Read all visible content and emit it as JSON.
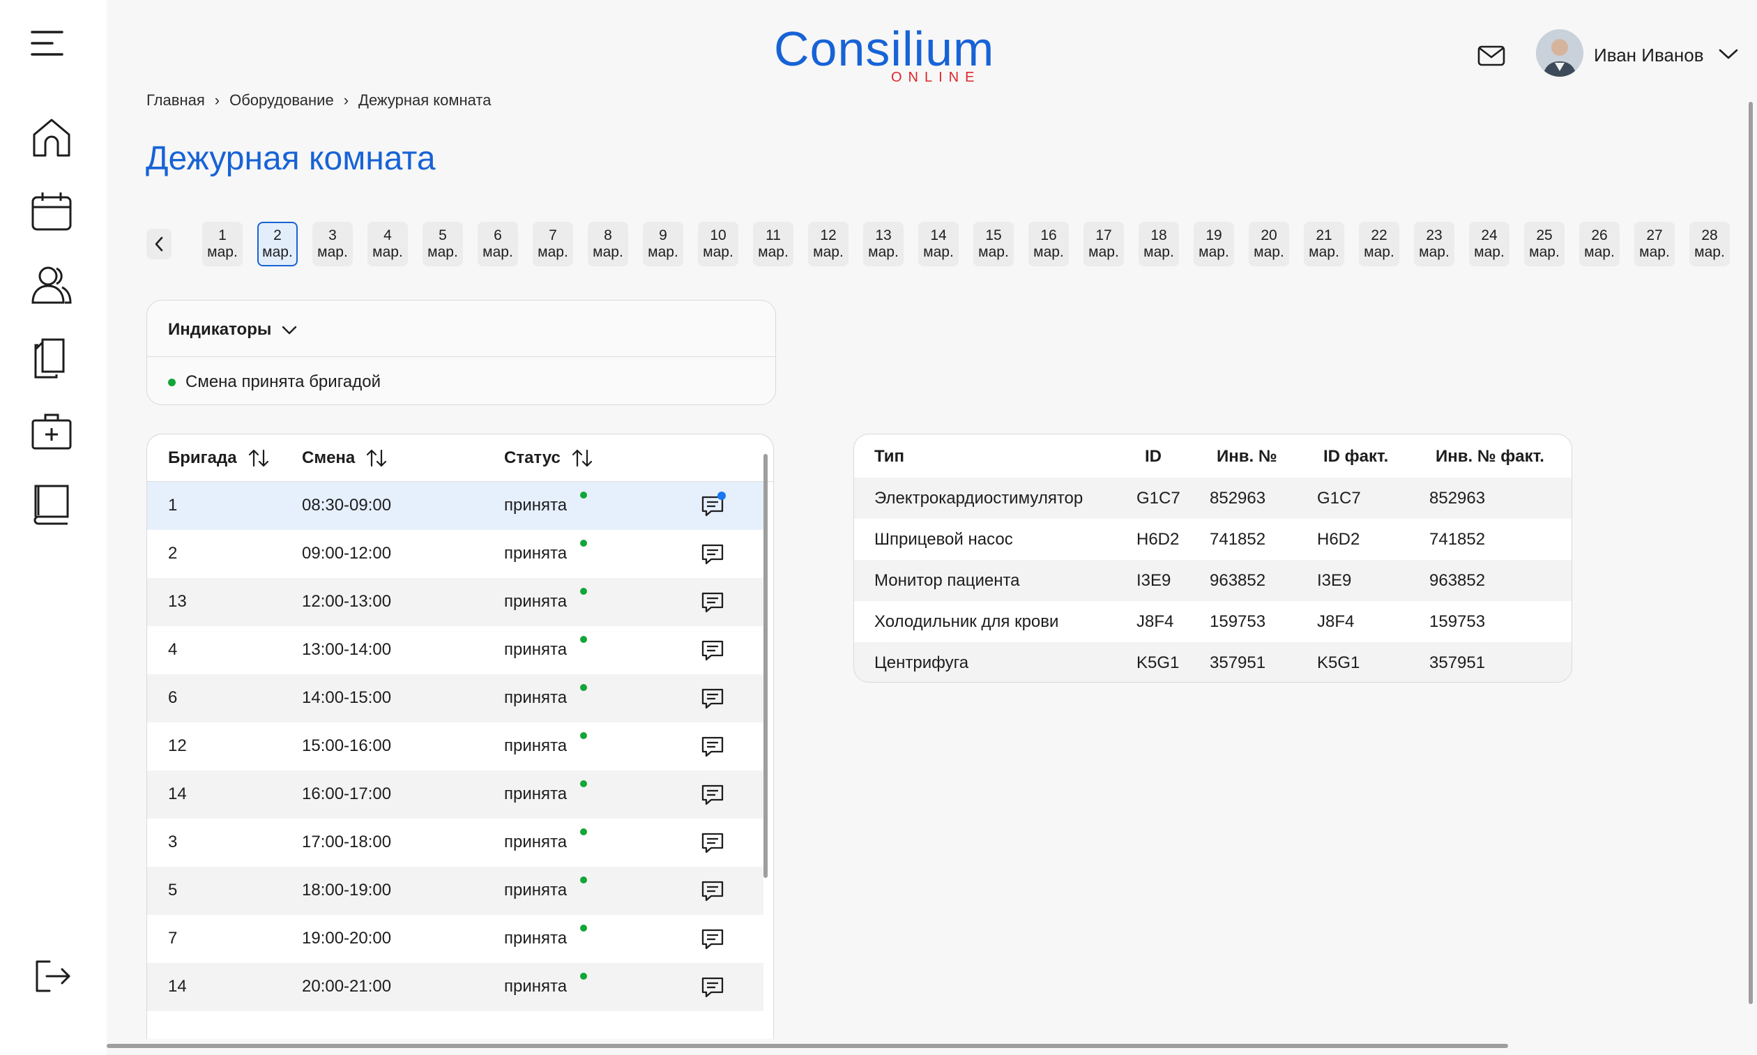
{
  "header": {
    "logo_main": "Consilium",
    "logo_sub": "ONLINE",
    "user_name": "Иван Иванов"
  },
  "sidebar": {
    "icons": [
      "menu-icon",
      "home-icon",
      "calendar-icon",
      "patients-icon",
      "documents-icon",
      "medkit-icon",
      "book-icon",
      "logout-icon"
    ]
  },
  "breadcrumb": [
    "Главная",
    "Оборудование",
    "Дежурная комната"
  ],
  "page_title": "Дежурная комната",
  "dates": {
    "month": "мар.",
    "days": [
      "1",
      "2",
      "3",
      "4",
      "5",
      "6",
      "7",
      "8",
      "9",
      "10",
      "11",
      "12",
      "13",
      "14",
      "15",
      "16",
      "17",
      "18",
      "19",
      "20",
      "21",
      "22",
      "23",
      "24",
      "25",
      "26",
      "27",
      "28"
    ],
    "selected": "2"
  },
  "indicators": {
    "title": "Индикаторы",
    "items": [
      {
        "label": "Смена принята бригадой",
        "color": "#13a538"
      }
    ]
  },
  "brigades": {
    "columns": [
      "Бригада",
      "Смена",
      "Статус"
    ],
    "rows": [
      {
        "brigade": "1",
        "shift": "08:30-09:00",
        "status": "принята",
        "unread": true
      },
      {
        "brigade": "2",
        "shift": "09:00-12:00",
        "status": "принята",
        "unread": false
      },
      {
        "brigade": "13",
        "shift": "12:00-13:00",
        "status": "принята",
        "unread": false
      },
      {
        "brigade": "4",
        "shift": "13:00-14:00",
        "status": "принята",
        "unread": false
      },
      {
        "brigade": "6",
        "shift": "14:00-15:00",
        "status": "принята",
        "unread": false
      },
      {
        "brigade": "12",
        "shift": "15:00-16:00",
        "status": "принята",
        "unread": false
      },
      {
        "brigade": "14",
        "shift": "16:00-17:00",
        "status": "принята",
        "unread": false
      },
      {
        "brigade": "3",
        "shift": "17:00-18:00",
        "status": "принята",
        "unread": false
      },
      {
        "brigade": "5",
        "shift": "18:00-19:00",
        "status": "принята",
        "unread": false
      },
      {
        "brigade": "7",
        "shift": "19:00-20:00",
        "status": "принята",
        "unread": false
      },
      {
        "brigade": "14",
        "shift": "20:00-21:00",
        "status": "принята",
        "unread": false
      }
    ]
  },
  "equipment": {
    "columns": [
      "Тип",
      "ID",
      "Инв. №",
      "ID факт.",
      "Инв. № факт."
    ],
    "rows": [
      [
        "Электрокардиостимулятор",
        "G1C7",
        "852963",
        "G1C7",
        "852963"
      ],
      [
        "Шприцевой насос",
        "H6D2",
        "741852",
        "H6D2",
        "741852"
      ],
      [
        "Монитор пациента",
        "I3E9",
        "963852",
        "I3E9",
        "963852"
      ],
      [
        "Холодильник для крови",
        "J8F4",
        "159753",
        "J8F4",
        "159753"
      ],
      [
        "Центрифуга",
        "K5G1",
        "357951",
        "K5G1",
        "357951"
      ]
    ]
  },
  "colors": {
    "accent": "#1763d6",
    "logo_red": "#e0242b",
    "status_green": "#13a538",
    "notification": "#1877f2"
  }
}
